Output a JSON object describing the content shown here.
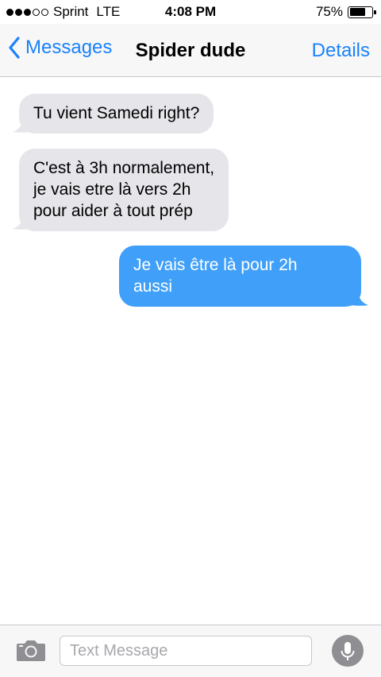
{
  "status_bar": {
    "carrier": "Sprint",
    "network": "LTE",
    "time": "4:08 PM",
    "battery_percent_label": "75%",
    "battery_level": 0.75,
    "signal_strength": 3,
    "signal_max": 5
  },
  "nav": {
    "back_label": "Messages",
    "title": "Spider dude",
    "details_label": "Details",
    "accent_color": "#1a82fb"
  },
  "messages": [
    {
      "direction": "incoming",
      "lines": [
        "Tu vient Samedi right?"
      ]
    },
    {
      "direction": "incoming",
      "lines": [
        "C'est à 3h normalement,",
        "je vais etre là vers 2h",
        "pour aider à tout prép"
      ]
    },
    {
      "direction": "outgoing",
      "lines": [
        "Je vais être là pour 2h",
        "aussi"
      ]
    }
  ],
  "colors": {
    "incoming_bubble": "#e5e5ea",
    "outgoing_bubble": "#40a0f9"
  },
  "input": {
    "placeholder": "Text Message",
    "value": ""
  },
  "icons": {
    "back": "chevron-left-icon",
    "camera": "camera-icon",
    "mic": "microphone-icon",
    "battery": "battery-icon"
  }
}
